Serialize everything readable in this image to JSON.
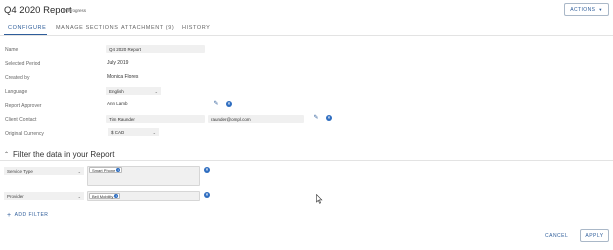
{
  "header": {
    "title": "Q4 2020 Report",
    "status": "In Progress",
    "actions_label": "ACTIONS"
  },
  "tabs": [
    {
      "label": "CONFIGURE",
      "active": true
    },
    {
      "label": "MANAGE SECTIONS",
      "active": false
    },
    {
      "label": "ATTACHMENT (9)",
      "active": false
    },
    {
      "label": "HISTORY",
      "active": false
    }
  ],
  "form": {
    "name": {
      "label": "Name",
      "value": "Q4 2020 Report"
    },
    "period": {
      "label": "Selected Period",
      "value": "July 2019"
    },
    "created_by": {
      "label": "Created by",
      "value": "Monica Flores"
    },
    "language": {
      "label": "Language",
      "value": "English"
    },
    "approver": {
      "label": "Report Approver",
      "value": "Ann Lamb"
    },
    "client_contact": {
      "label": "Client Contact",
      "name": "Tim Raunder",
      "email": "raunder@ompl.com"
    },
    "currency": {
      "label": "Original Currency",
      "value": "$ CAD"
    }
  },
  "filters": {
    "section_title": "Filter the data in your Report",
    "rows": [
      {
        "field": "Service Type",
        "chips": [
          "Smart Phone"
        ]
      },
      {
        "field": "Provider",
        "chips": [
          "Bell Mobility"
        ]
      }
    ],
    "add_label": "ADD FILTER"
  },
  "footer": {
    "cancel_label": "CANCEL",
    "apply_label": "APPLY"
  },
  "colors": {
    "accent": "#2e5d9a",
    "field_bg": "#f0f0f0"
  }
}
